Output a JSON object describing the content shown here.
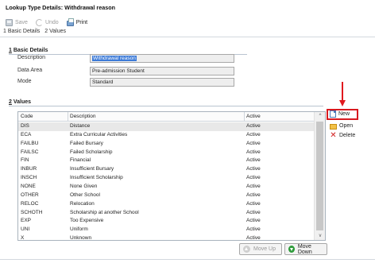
{
  "window": {
    "title": "Lookup Type Details: Withdrawal reason"
  },
  "toolbar": {
    "save_label": "Save",
    "undo_label": "Undo",
    "print_label": "Print"
  },
  "nav": {
    "items": [
      "1 Basic Details",
      "2 Values"
    ]
  },
  "basic_details": {
    "number": "1",
    "title": "Basic Details",
    "fields": [
      {
        "label": "Description",
        "value": "Withdrawal reason"
      },
      {
        "label": "Data Area",
        "value": "Pre-admission Student"
      },
      {
        "label": "Mode",
        "value": "Standard"
      }
    ]
  },
  "values_section": {
    "number": "2",
    "title": "Values",
    "columns": [
      "Code",
      "Description",
      "Active"
    ],
    "rows": [
      {
        "code": "DIS",
        "description": "Distance",
        "active": "Active",
        "selected": true
      },
      {
        "code": "ECA",
        "description": "Extra Curricular Activities",
        "active": "Active"
      },
      {
        "code": "FAILBU",
        "description": "Failed Bursary",
        "active": "Active"
      },
      {
        "code": "FAILSC",
        "description": "Failed Scholarship",
        "active": "Active"
      },
      {
        "code": "FIN",
        "description": "Financial",
        "active": "Active"
      },
      {
        "code": "INBUR",
        "description": "Insufficient Bursary",
        "active": "Active"
      },
      {
        "code": "INSCH",
        "description": "Insufficient Scholarship",
        "active": "Active"
      },
      {
        "code": "NONE",
        "description": "None Given",
        "active": "Active"
      },
      {
        "code": "OTHER",
        "description": "Other School",
        "active": "Active"
      },
      {
        "code": "RELOC",
        "description": "Relocation",
        "active": "Active"
      },
      {
        "code": "SCHOTH",
        "description": "Scholarship at another School",
        "active": "Active"
      },
      {
        "code": "EXP",
        "description": "Too Expensive",
        "active": "Active"
      },
      {
        "code": "UNI",
        "description": "Uniform",
        "active": "Active"
      },
      {
        "code": "X",
        "description": "Unknown",
        "active": "Active"
      }
    ],
    "side_buttons": {
      "new_label": "New",
      "open_label": "Open",
      "delete_label": "Delete"
    },
    "move_up_label": "Move Up",
    "move_down_label": "Move Down"
  },
  "colors": {
    "highlight_red": "#e0191e",
    "selection_blue": "#3d7bd8"
  },
  "icons": {
    "save": "save-icon",
    "undo": "undo-icon",
    "print": "printer-icon",
    "new": "new-document-icon",
    "open": "folder-open-icon",
    "delete": "delete-x-icon",
    "move_up": "arrow-up-circle-icon",
    "move_down": "arrow-down-circle-icon"
  }
}
